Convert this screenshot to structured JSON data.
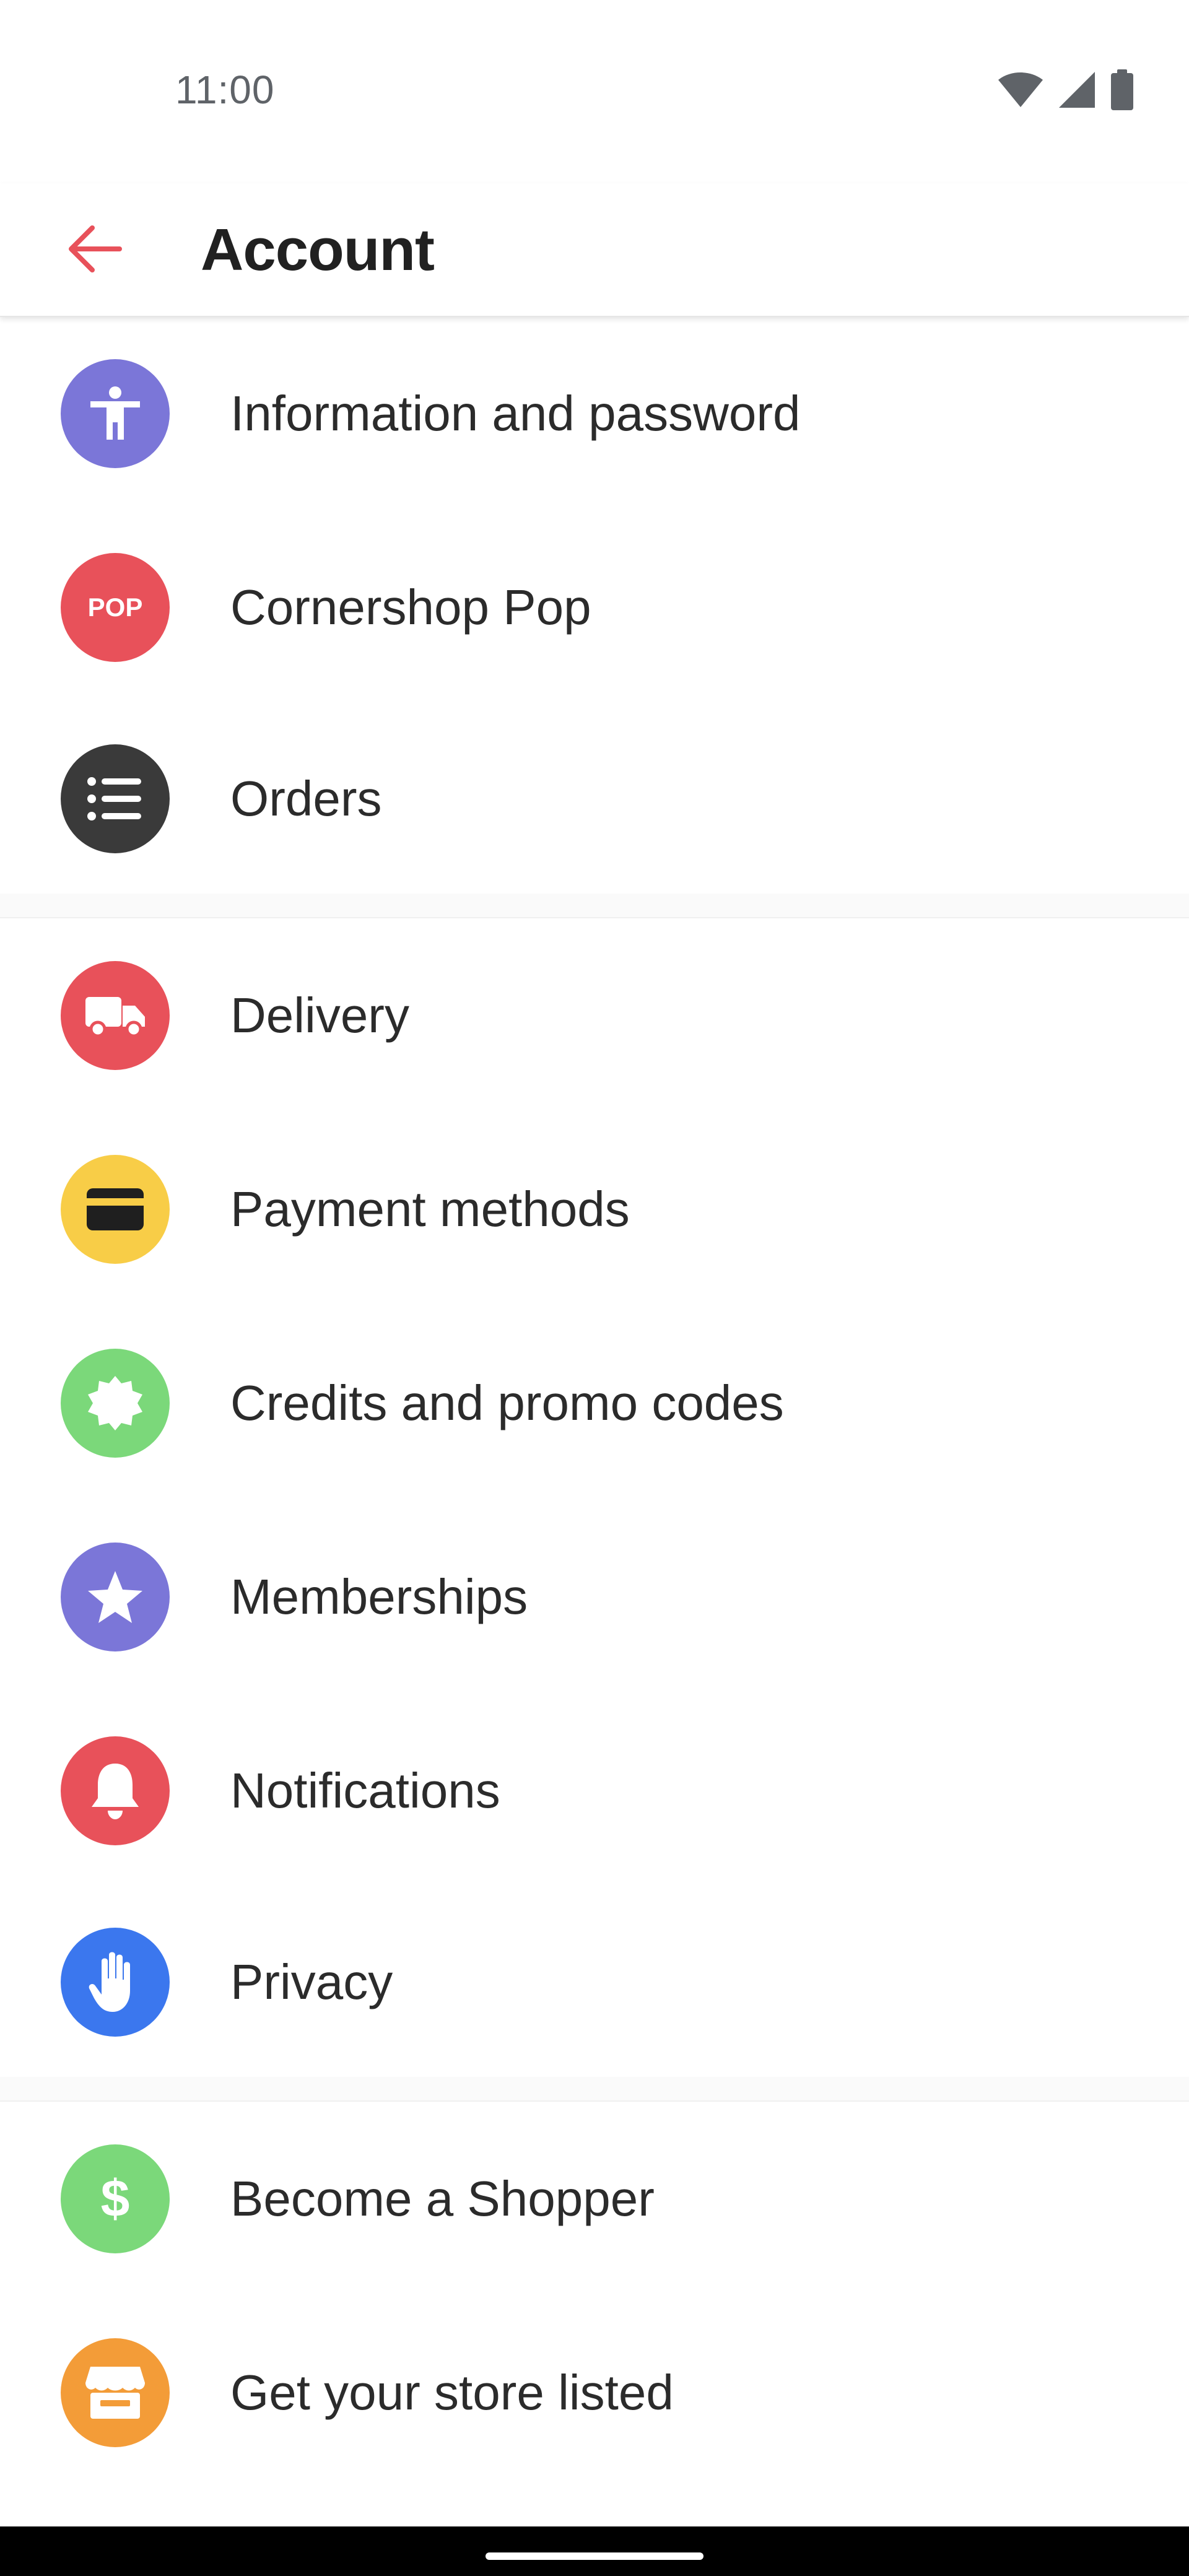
{
  "status_bar": {
    "time": "11:00",
    "icons": [
      "wifi-icon",
      "cellular-signal-icon",
      "battery-icon"
    ]
  },
  "app_bar": {
    "back_icon": "arrow-back-icon",
    "title": "Account"
  },
  "colors": {
    "accent": "#e8515a",
    "purple": "#7b76d8",
    "red": "#e8515a",
    "dark": "#3a3a3a",
    "yellow": "#f8cd47",
    "green": "#7bd87a",
    "blue": "#3b77ee",
    "orange": "#f39c38"
  },
  "sections": [
    {
      "items": [
        {
          "label": "Information and password",
          "icon": "accessibility-person-icon",
          "color": "#7b76d8"
        },
        {
          "label": "Cornershop Pop",
          "icon": "pop-logo-icon",
          "icon_text": "POP",
          "color": "#e8515a"
        },
        {
          "label": "Orders",
          "icon": "list-icon",
          "color": "#3a3a3a"
        }
      ]
    },
    {
      "items": [
        {
          "label": "Delivery",
          "icon": "truck-icon",
          "color": "#e8515a"
        },
        {
          "label": "Payment methods",
          "icon": "credit-card-icon",
          "color": "#f8cd47"
        },
        {
          "label": "Credits and promo codes",
          "icon": "badge-icon",
          "color": "#7bd87a"
        },
        {
          "label": "Memberships",
          "icon": "star-icon",
          "color": "#7b76d8"
        },
        {
          "label": "Notifications",
          "icon": "bell-icon",
          "color": "#e8515a"
        },
        {
          "label": "Privacy",
          "icon": "hand-stop-icon",
          "color": "#3b77ee"
        }
      ]
    },
    {
      "items": [
        {
          "label": "Become a Shopper",
          "icon": "dollar-sign-icon",
          "icon_text": "$",
          "color": "#7bd87a"
        },
        {
          "label": "Get your store listed",
          "icon": "storefront-icon",
          "color": "#f39c38"
        }
      ]
    }
  ]
}
